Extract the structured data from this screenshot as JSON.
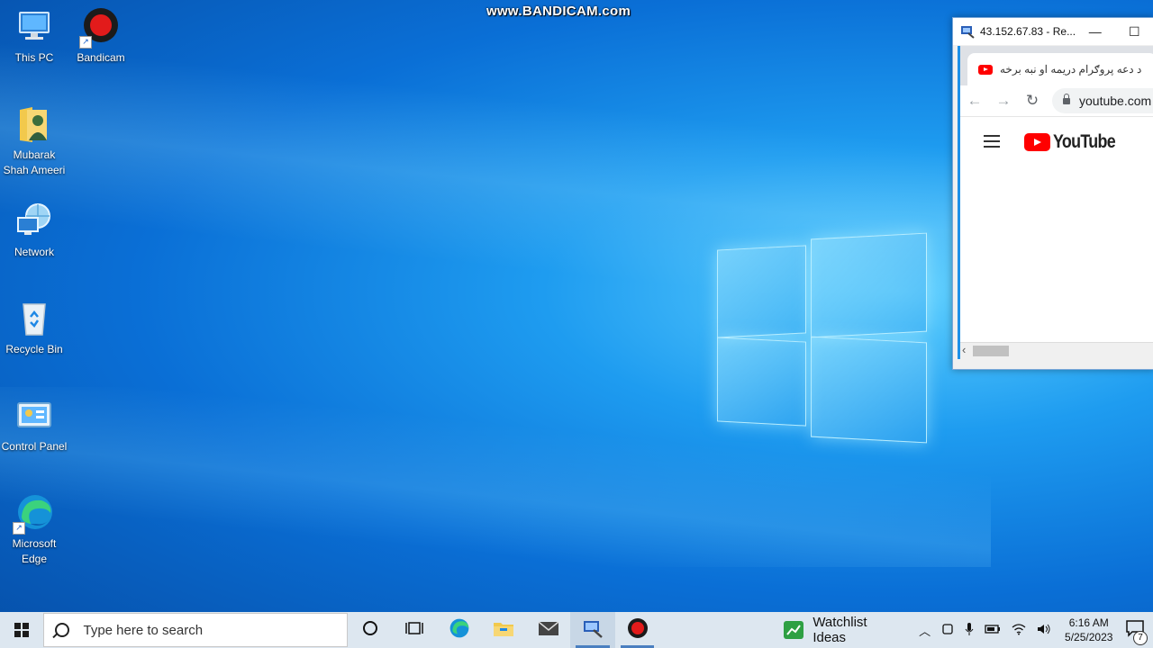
{
  "watermark": "www.BANDICAM.com",
  "desktop": {
    "icons": [
      {
        "label": "This PC",
        "icon": "this-pc-icon"
      },
      {
        "label": "Bandicam",
        "icon": "bandicam-icon"
      },
      {
        "label": "Mubarak Shah Ameeri",
        "icon": "user-folder-icon"
      },
      {
        "label": "Network",
        "icon": "network-icon"
      },
      {
        "label": "Recycle Bin",
        "icon": "recycle-bin-icon"
      },
      {
        "label": "Control Panel",
        "icon": "control-panel-icon"
      },
      {
        "label": "Microsoft Edge",
        "icon": "edge-icon"
      }
    ]
  },
  "rdp_window": {
    "title": "43.152.67.83 - Re...",
    "browser": {
      "tab_title": "د دعه پروګرام دریمه او نبه برخه",
      "address": "youtube.com",
      "page_logo": "YouTube"
    }
  },
  "taskbar": {
    "search_placeholder": "Type here to search",
    "pinned": [
      "cortana-icon",
      "task-view-icon",
      "edge-icon",
      "file-explorer-icon",
      "mail-icon",
      "remote-desktop-icon",
      "bandicam-icon"
    ],
    "widget_label": "Watchlist Ideas",
    "time": "6:16 AM",
    "date": "5/25/2023",
    "notification_count": "7"
  },
  "colors": {
    "accent": "#1e90e8",
    "youtube_red": "#ff0000",
    "bandicam_red": "#e21b1b",
    "taskbar_bg": "#dde7f0"
  }
}
